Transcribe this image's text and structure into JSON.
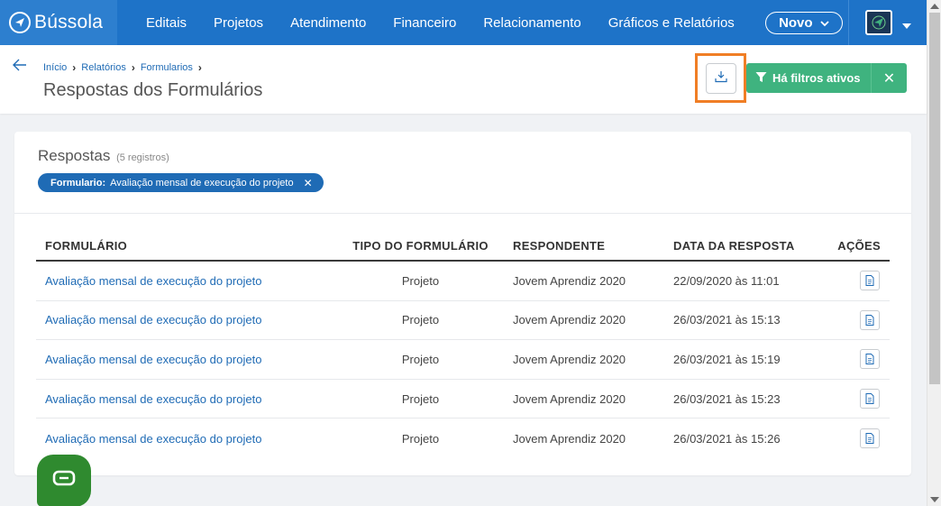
{
  "app": {
    "name": "Bússola"
  },
  "nav": {
    "items": [
      "Editais",
      "Projetos",
      "Atendimento",
      "Financeiro",
      "Relacionamento",
      "Gráficos e Relatórios"
    ],
    "new_button": "Novo"
  },
  "breadcrumb": [
    "Início",
    "Relatórios",
    "Formularios"
  ],
  "page": {
    "title": "Respostas dos Formulários"
  },
  "filters": {
    "label": "Há filtros ativos"
  },
  "card": {
    "title": "Respostas",
    "count": "(5 registros)",
    "chip_key": "Formulario:",
    "chip_value": "Avaliação mensal de execução do projeto"
  },
  "table": {
    "headers": [
      "FORMULÁRIO",
      "TIPO DO FORMULÁRIO",
      "RESPONDENTE",
      "DATA DA RESPOSTA",
      "AÇÕES"
    ],
    "rows": [
      [
        "Avaliação mensal de execução do projeto",
        "Projeto",
        "Jovem Aprendiz 2020",
        "22/09/2020 às 11:01"
      ],
      [
        "Avaliação mensal de execução do projeto",
        "Projeto",
        "Jovem Aprendiz 2020",
        "26/03/2021 às 15:13"
      ],
      [
        "Avaliação mensal de execução do projeto",
        "Projeto",
        "Jovem Aprendiz 2020",
        "26/03/2021 às 15:19"
      ],
      [
        "Avaliação mensal de execução do projeto",
        "Projeto",
        "Jovem Aprendiz 2020",
        "26/03/2021 às 15:23"
      ],
      [
        "Avaliação mensal de execução do projeto",
        "Projeto",
        "Jovem Aprendiz 2020",
        "26/03/2021 às 15:26"
      ]
    ]
  },
  "icons": {
    "back": "arrow-left-icon",
    "download": "download-icon",
    "filter": "filter-icon",
    "close": "close-icon",
    "document": "document-icon",
    "chat": "chat-icon"
  },
  "colors": {
    "nav_bg": "#1e73c8",
    "primary": "#1f6bb5",
    "success": "#3fb37f",
    "highlight": "#f07e25",
    "chat": "#2f8a2f"
  }
}
